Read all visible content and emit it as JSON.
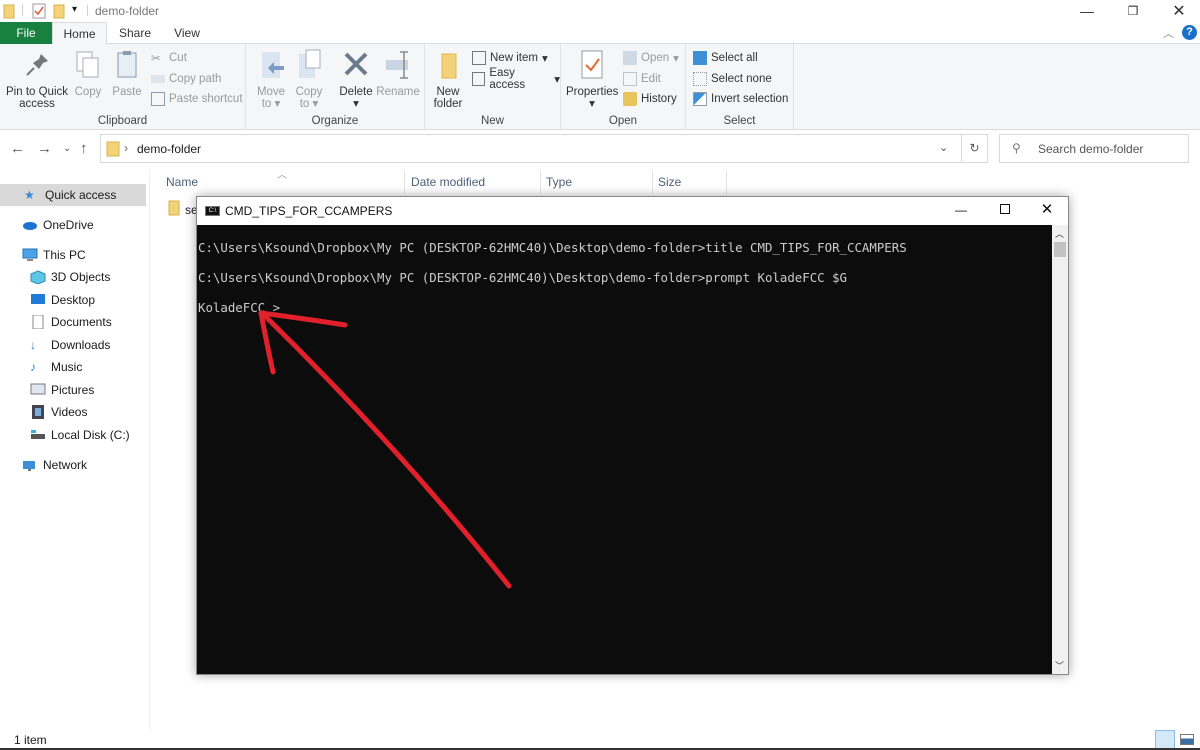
{
  "window": {
    "title": "demo-folder",
    "minimize_icon": "minimize-icon",
    "restore_icon": "restore-icon",
    "close_icon": "close-icon"
  },
  "tabs": [
    {
      "label": "File"
    },
    {
      "label": "Home"
    },
    {
      "label": "Share"
    },
    {
      "label": "View"
    }
  ],
  "ribbon": {
    "clipboard": {
      "label": "Clipboard",
      "pin_line1": "Pin to Quick",
      "pin_line2": "access",
      "copy": "Copy",
      "paste": "Paste",
      "cut": "Cut",
      "copy_path": "Copy path",
      "paste_shortcut": "Paste shortcut"
    },
    "organize": {
      "label": "Organize",
      "move_line1": "Move",
      "move_line2": "to",
      "copy_line1": "Copy",
      "copy_line2": "to",
      "delete": "Delete",
      "rename": "Rename"
    },
    "new": {
      "label": "New",
      "folder_line1": "New",
      "folder_line2": "folder",
      "new_item": "New item",
      "easy_access": "Easy access"
    },
    "open": {
      "label": "Open",
      "properties": "Properties",
      "open": "Open",
      "edit": "Edit",
      "history": "History"
    },
    "select": {
      "label": "Select",
      "select_all": "Select all",
      "select_none": "Select none",
      "invert": "Invert selection"
    }
  },
  "address": {
    "path": "demo-folder",
    "search_placeholder": "Search demo-folder"
  },
  "nav_pane": {
    "items": [
      {
        "label": "Quick access",
        "icon": "star-icon",
        "selected": true
      },
      {
        "label": "OneDrive",
        "icon": "cloud-icon"
      },
      {
        "label": "This PC",
        "icon": "computer-icon"
      },
      {
        "label": "3D Objects",
        "icon": "cube-icon"
      },
      {
        "label": "Desktop",
        "icon": "desktop-icon"
      },
      {
        "label": "Documents",
        "icon": "document-icon"
      },
      {
        "label": "Downloads",
        "icon": "download-icon"
      },
      {
        "label": "Music",
        "icon": "music-icon"
      },
      {
        "label": "Pictures",
        "icon": "picture-icon"
      },
      {
        "label": "Videos",
        "icon": "video-icon"
      },
      {
        "label": "Local Disk (C:)",
        "icon": "disk-icon"
      },
      {
        "label": "Network",
        "icon": "network-icon"
      }
    ]
  },
  "file_list": {
    "columns": [
      "Name",
      "Date modified",
      "Type",
      "Size"
    ],
    "rows": [
      {
        "name": "se"
      }
    ]
  },
  "cmd": {
    "title": "CMD_TIPS_FOR_CCAMPERS",
    "lines": [
      "C:\\Users\\Ksound\\Dropbox\\My PC (DESKTOP-62HMC40)\\Desktop\\demo-folder>title CMD_TIPS_FOR_CCAMPERS",
      "C:\\Users\\Ksound\\Dropbox\\My PC (DESKTOP-62HMC40)\\Desktop\\demo-folder>prompt KoladeFCC $G",
      "KoladeFCC >"
    ],
    "annotation_color": "#e0202a"
  },
  "status": {
    "item_count": "1 item"
  },
  "colors": {
    "file_tab": "#19813f",
    "ribbon_bg": "#f5f6f7",
    "console_bg": "#0c0c0c",
    "console_text": "#cccccc"
  }
}
